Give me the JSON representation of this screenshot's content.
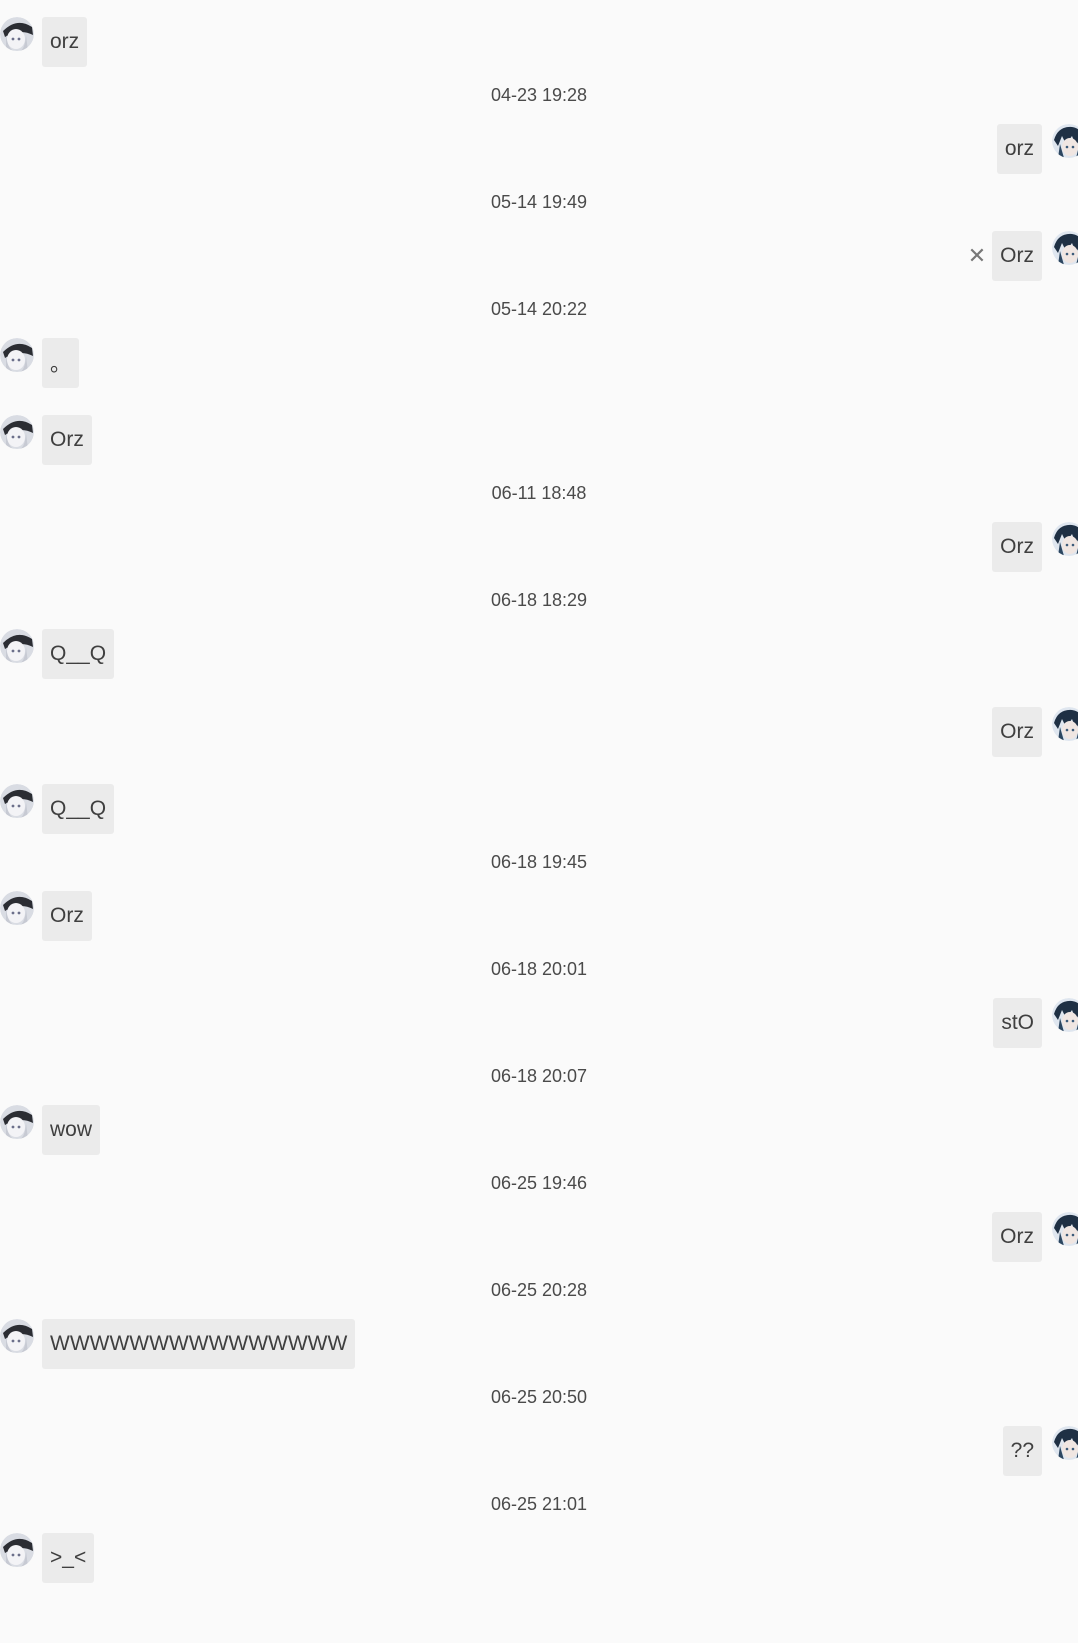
{
  "messages": [
    {
      "type": "msg",
      "side": "left",
      "text": "orz"
    },
    {
      "type": "time",
      "text": "04-23 19:28"
    },
    {
      "type": "msg",
      "side": "right",
      "text": "orz"
    },
    {
      "type": "time",
      "text": "05-14 19:49"
    },
    {
      "type": "msg",
      "side": "right",
      "text": "Orz",
      "failed": true
    },
    {
      "type": "time",
      "text": "05-14 20:22"
    },
    {
      "type": "msg",
      "side": "left",
      "text": "。"
    },
    {
      "type": "msg",
      "side": "left",
      "text": "Orz"
    },
    {
      "type": "time",
      "text": "06-11 18:48"
    },
    {
      "type": "msg",
      "side": "right",
      "text": "Orz"
    },
    {
      "type": "time",
      "text": "06-18 18:29"
    },
    {
      "type": "msg",
      "side": "left",
      "text": "Q__Q"
    },
    {
      "type": "msg",
      "side": "right",
      "text": "Orz"
    },
    {
      "type": "msg",
      "side": "left",
      "text": "Q__Q"
    },
    {
      "type": "time",
      "text": "06-18 19:45"
    },
    {
      "type": "msg",
      "side": "left",
      "text": "Orz"
    },
    {
      "type": "time",
      "text": "06-18 20:01"
    },
    {
      "type": "msg",
      "side": "right",
      "text": "stO"
    },
    {
      "type": "time",
      "text": "06-18 20:07"
    },
    {
      "type": "msg",
      "side": "left",
      "text": "wow"
    },
    {
      "type": "time",
      "text": "06-25 19:46"
    },
    {
      "type": "msg",
      "side": "right",
      "text": "Orz"
    },
    {
      "type": "time",
      "text": "06-25 20:28"
    },
    {
      "type": "msg",
      "side": "left",
      "text": "WWWWWWWWWWWWWWW"
    },
    {
      "type": "time",
      "text": "06-25 20:50"
    },
    {
      "type": "msg",
      "side": "right",
      "text": "??"
    },
    {
      "type": "time",
      "text": "06-25 21:01"
    },
    {
      "type": "msg",
      "side": "left",
      "text": ">_<"
    }
  ],
  "icons": {
    "failed": "close-icon",
    "failed_glyph": "✕",
    "left_avatar": "user-avatar-silver-hair",
    "right_avatar": "user-avatar-dark-hair"
  },
  "colors": {
    "background": "#fafafa",
    "bubble": "#ebebeb",
    "text": "#3f3f3f",
    "timestamp": "#4a4a4a"
  }
}
